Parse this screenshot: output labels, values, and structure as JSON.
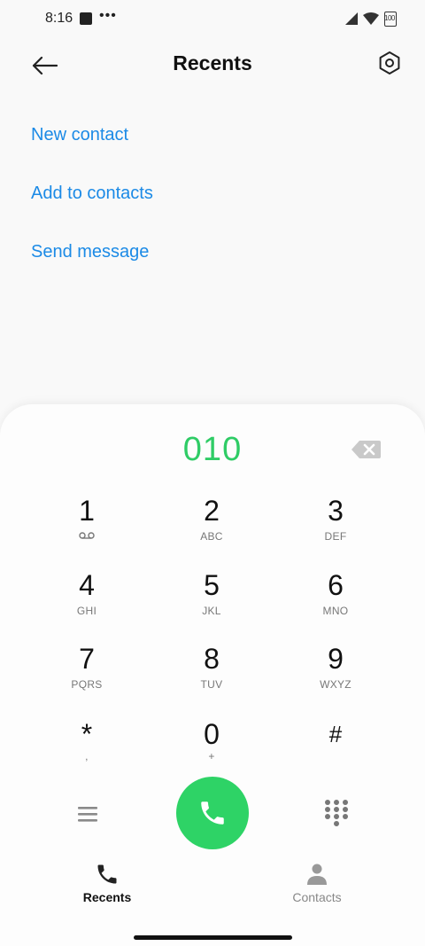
{
  "status_bar": {
    "time": "8:16",
    "more": "•••",
    "battery": "100"
  },
  "header": {
    "title": "Recents"
  },
  "actions": [
    {
      "label": "New contact"
    },
    {
      "label": "Add to contacts"
    },
    {
      "label": "Send message"
    }
  ],
  "dialer": {
    "number": "010",
    "keys": [
      {
        "digit": "1",
        "letters": ""
      },
      {
        "digit": "2",
        "letters": "ABC"
      },
      {
        "digit": "3",
        "letters": "DEF"
      },
      {
        "digit": "4",
        "letters": "GHI"
      },
      {
        "digit": "5",
        "letters": "JKL"
      },
      {
        "digit": "6",
        "letters": "MNO"
      },
      {
        "digit": "7",
        "letters": "PQRS"
      },
      {
        "digit": "8",
        "letters": "TUV"
      },
      {
        "digit": "9",
        "letters": "WXYZ"
      },
      {
        "digit": "*",
        "letters": ","
      },
      {
        "digit": "0",
        "letters": "+"
      },
      {
        "digit": "#",
        "letters": ""
      }
    ]
  },
  "bottom_nav": {
    "tabs": [
      {
        "label": "Recents",
        "active": true
      },
      {
        "label": "Contacts",
        "active": false
      }
    ]
  },
  "colors": {
    "accent_link": "#1b8ae6",
    "dial_number": "#2fcc66",
    "call_button": "#2ed366"
  },
  "icons": {
    "back": "arrow-left-icon",
    "settings": "hexagon-settings-icon",
    "backspace": "backspace-icon",
    "voicemail": "voicemail-icon",
    "menu": "menu-icon",
    "call": "phone-icon",
    "dialpad": "dialpad-icon",
    "contacts": "person-icon"
  }
}
